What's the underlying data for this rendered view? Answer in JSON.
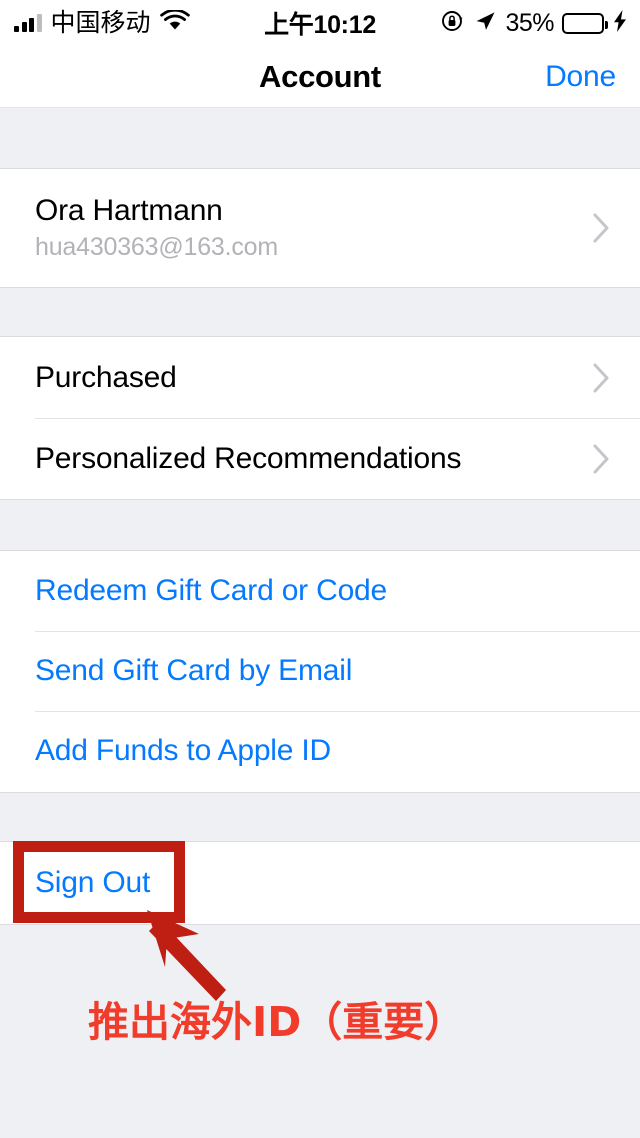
{
  "status_bar": {
    "carrier": "中国移动",
    "signal_icon": "signal-bars-icon",
    "wifi_icon": "wifi-icon",
    "time": "上午10:12",
    "rotation_lock_icon": "rotation-lock-icon",
    "location_icon": "location-arrow-icon",
    "battery_percent": "35%",
    "battery_level": 35,
    "charging_icon": "lightning-bolt-icon",
    "battery_color": "#3ddc55"
  },
  "nav_bar": {
    "title": "Account",
    "done_label": "Done",
    "accent_color": "#057aff"
  },
  "groups": [
    {
      "id": "account",
      "rows": [
        {
          "title": "Ora Hartmann",
          "subtitle": "hua430363@163.com",
          "accessory": "chevron-right-icon"
        }
      ]
    },
    {
      "id": "store",
      "rows": [
        {
          "title": "Purchased",
          "accessory": "chevron-right-icon"
        },
        {
          "title": "Personalized Recommendations",
          "accessory": "chevron-right-icon"
        }
      ]
    },
    {
      "id": "giftcards",
      "rows": [
        {
          "title": "Redeem Gift Card or Code"
        },
        {
          "title": "Send Gift Card by Email"
        },
        {
          "title": "Add Funds to Apple ID"
        }
      ]
    },
    {
      "id": "signout",
      "rows": [
        {
          "title": "Sign Out"
        }
      ]
    }
  ],
  "annotation": {
    "highlight_target": "Sign Out",
    "arrow_icon": "annotation-arrow-icon",
    "caption": "推出海外ID（重要）",
    "box_color": "#bf1e12",
    "arrow_color": "#bf1e12",
    "text_color": "#f13c2c"
  }
}
